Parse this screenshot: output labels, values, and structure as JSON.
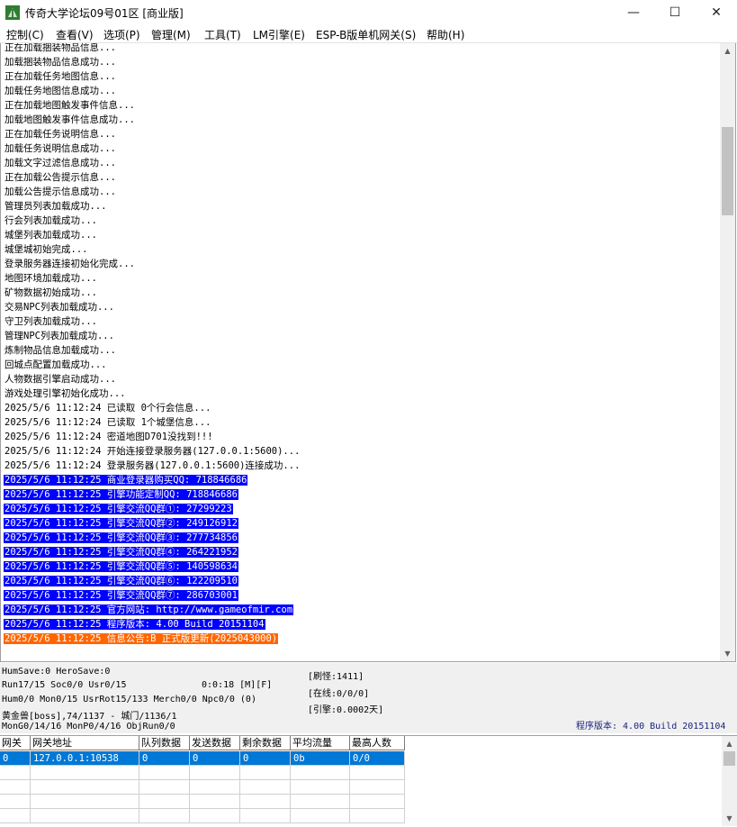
{
  "window": {
    "title": "传奇大学论坛09号01区 [商业版]",
    "minimize_glyph": "—",
    "maximize_glyph": "☐",
    "close_glyph": "✕",
    "icon": "fern-app-icon"
  },
  "menu": [
    {
      "id": "control",
      "label": "控制(C)"
    },
    {
      "id": "view",
      "label": "查看(V)"
    },
    {
      "id": "options",
      "label": "选项(P)"
    },
    {
      "id": "manage",
      "label": "管理(M)"
    },
    {
      "id": "tools",
      "label": "工具(T)"
    },
    {
      "id": "lm-engine",
      "label": "LM引擎(E)"
    },
    {
      "id": "esp-gateway",
      "label": "ESP-B版单机网关(S)"
    },
    {
      "id": "help",
      "label": "帮助(H)"
    }
  ],
  "log": [
    {
      "text": "正在加载捆装物品信息...",
      "style": "normal"
    },
    {
      "text": "加载捆装物品信息成功...",
      "style": "normal"
    },
    {
      "text": "正在加载任务地图信息...",
      "style": "normal"
    },
    {
      "text": "加载任务地图信息成功...",
      "style": "normal"
    },
    {
      "text": "正在加载地图触发事件信息...",
      "style": "normal"
    },
    {
      "text": "加载地图触发事件信息成功...",
      "style": "normal"
    },
    {
      "text": "正在加载任务说明信息...",
      "style": "normal"
    },
    {
      "text": "加载任务说明信息成功...",
      "style": "normal"
    },
    {
      "text": "加载文字过滤信息成功...",
      "style": "normal"
    },
    {
      "text": "正在加载公告提示信息...",
      "style": "normal"
    },
    {
      "text": "加载公告提示信息成功...",
      "style": "normal"
    },
    {
      "text": "管理员列表加载成功...",
      "style": "normal"
    },
    {
      "text": "行会列表加载成功...",
      "style": "normal"
    },
    {
      "text": "城堡列表加载成功...",
      "style": "normal"
    },
    {
      "text": "城堡城初始完成...",
      "style": "normal"
    },
    {
      "text": "登录服务器连接初始化完成...",
      "style": "normal"
    },
    {
      "text": "地图环境加载成功...",
      "style": "normal"
    },
    {
      "text": "矿物数据初始成功...",
      "style": "normal"
    },
    {
      "text": "交易NPC列表加载成功...",
      "style": "normal"
    },
    {
      "text": "守卫列表加载成功...",
      "style": "normal"
    },
    {
      "text": "管理NPC列表加载成功...",
      "style": "normal"
    },
    {
      "text": "炼制物品信息加载成功...",
      "style": "normal"
    },
    {
      "text": "回城点配置加载成功...",
      "style": "normal"
    },
    {
      "text": "人物数据引擎启动成功...",
      "style": "normal"
    },
    {
      "text": "游戏处理引擎初始化成功...",
      "style": "normal"
    },
    {
      "text": "2025/5/6 11:12:24 已读取 0个行会信息...",
      "style": "normal"
    },
    {
      "text": "2025/5/6 11:12:24 已读取 1个城堡信息...",
      "style": "normal"
    },
    {
      "text": "2025/5/6 11:12:24 密道地图D701没找到!!!",
      "style": "normal"
    },
    {
      "text": "2025/5/6 11:12:24 开始连接登录服务器(127.0.0.1:5600)...",
      "style": "normal"
    },
    {
      "text": "2025/5/6 11:12:24 登录服务器(127.0.0.1:5600)连接成功...",
      "style": "normal"
    },
    {
      "text": "2025/5/6 11:12:25 商业登录器购买QQ: 718846686",
      "style": "blue"
    },
    {
      "text": "2025/5/6 11:12:25 引擎功能定制QQ: 718846686",
      "style": "blue"
    },
    {
      "text": "2025/5/6 11:12:25 引擎交流QQ群①: 27299223",
      "style": "blue"
    },
    {
      "text": "2025/5/6 11:12:25 引擎交流QQ群②: 249126912",
      "style": "blue"
    },
    {
      "text": "2025/5/6 11:12:25 引擎交流QQ群③: 277734856",
      "style": "blue"
    },
    {
      "text": "2025/5/6 11:12:25 引擎交流QQ群④: 264221952",
      "style": "blue"
    },
    {
      "text": "2025/5/6 11:12:25 引擎交流QQ群⑤: 140598634",
      "style": "blue"
    },
    {
      "text": "2025/5/6 11:12:25 引擎交流QQ群⑥: 122209510",
      "style": "blue"
    },
    {
      "text": "2025/5/6 11:12:25 引擎交流QQ群⑦: 286703001",
      "style": "blue"
    },
    {
      "text": "2025/5/6 11:12:25 官方网站: http://www.gameofmir.com",
      "style": "blue"
    },
    {
      "text": "2025/5/6 11:12:25 程序版本: 4.00 Build 20151104",
      "style": "blue"
    },
    {
      "text": "2025/5/6 11:12:25 信息公告:B 正式版更新(2025043000)",
      "style": "orange"
    }
  ],
  "status": {
    "line1": "HumSave:0 HeroSave:0",
    "line2": "Run17/15 Soc0/0 Usr0/15",
    "timer": "0:0:18 [M][F]",
    "line3": "Hum0/0 Mon0/15 UsrRot15/133 Merch0/0 Npc0/0 (0)",
    "line4": "黄金兽[boss],74/1137 - 城门/1136/1",
    "line5": "MonG0/14/16 MonP0/4/16 ObjRun0/0",
    "refresh": "[刷怪:1411]",
    "online": "[在线:0/0/0]",
    "engine": "[引擎:0.0002天]",
    "version": "程序版本: 4.00 Build 20151104"
  },
  "gateway_table": {
    "headers": [
      "网关",
      "网关地址",
      "队列数据",
      "发送数据",
      "剩余数据",
      "平均流量",
      "最高人数"
    ],
    "rows": [
      [
        "0",
        "127.0.0.1:10538",
        "0",
        "0",
        "0",
        "0b",
        "0/0"
      ]
    ]
  },
  "colors": {
    "highlight_blue": "#0000ff",
    "highlight_orange": "#ff6600",
    "selection": "#0078d7"
  }
}
